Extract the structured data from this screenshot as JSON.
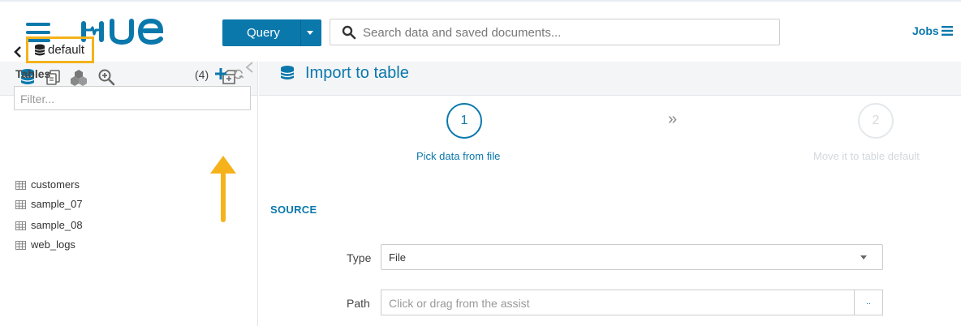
{
  "header": {
    "logo_text": "HUE",
    "query_button": {
      "label": "Query"
    },
    "search": {
      "placeholder": "Search data and saved documents..."
    },
    "jobs_label": "Jobs"
  },
  "assist_panel": {
    "icons": [
      "database-icon",
      "documents-icon",
      "cubes-icon",
      "zoom-in-icon"
    ],
    "database": "default",
    "tables_label": "Tables",
    "tables_count": "(4)",
    "filter_placeholder": "Filter...",
    "tables": [
      {
        "label": "customers"
      },
      {
        "label": "sample_07"
      },
      {
        "label": "sample_08"
      },
      {
        "label": "web_logs"
      }
    ]
  },
  "main": {
    "title": "Import to table",
    "steps": [
      {
        "number": "1",
        "label": "Pick data from file",
        "active": true
      },
      {
        "number": "2",
        "label": "Move it to table default",
        "active": false
      }
    ],
    "step_separator": "»",
    "section_title": "SOURCE",
    "type_label": "Type",
    "type_value": "File",
    "path_label": "Path",
    "path_placeholder": "Click or drag from the assist",
    "path_button_label": ".."
  },
  "colors": {
    "accent": "#0b78ac",
    "highlight": "#f5b21b",
    "panel_bg": "#f4f5f6"
  }
}
